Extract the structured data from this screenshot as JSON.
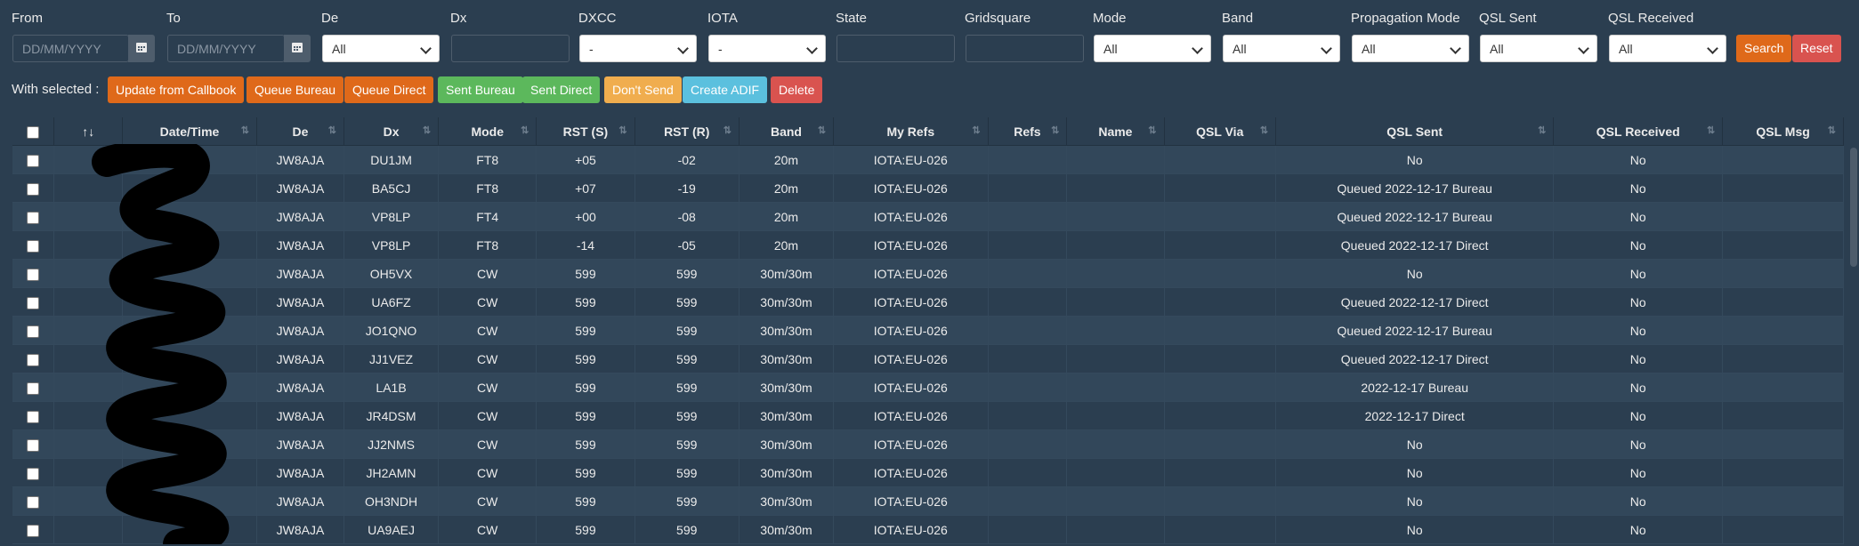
{
  "filters": {
    "from": {
      "label": "From",
      "placeholder": "DD/MM/YYYY"
    },
    "to": {
      "label": "To",
      "placeholder": "DD/MM/YYYY"
    },
    "de": {
      "label": "De",
      "value": "All"
    },
    "dx": {
      "label": "Dx",
      "value": ""
    },
    "dxcc": {
      "label": "DXCC",
      "value": "-"
    },
    "iota": {
      "label": "IOTA",
      "value": "-"
    },
    "state": {
      "label": "State",
      "value": ""
    },
    "gridsquare": {
      "label": "Gridsquare",
      "value": ""
    },
    "mode": {
      "label": "Mode",
      "value": "All"
    },
    "band": {
      "label": "Band",
      "value": "All"
    },
    "propagation": {
      "label": "Propagation Mode",
      "value": "All"
    },
    "qsl_sent": {
      "label": "QSL Sent",
      "value": "All"
    },
    "qsl_received": {
      "label": "QSL Received",
      "value": "All"
    },
    "search_label": "Search",
    "reset_label": "Reset"
  },
  "actions": {
    "with_selected_label": "With selected :",
    "update_callbook": "Update from Callbook",
    "queue_bureau": "Queue Bureau",
    "queue_direct": "Queue Direct",
    "sent_bureau": "Sent Bureau",
    "sent_direct": "Sent Direct",
    "dont_send": "Don't Send",
    "create_adif": "Create ADIF",
    "delete": "Delete"
  },
  "table": {
    "sort_first": "↑↓",
    "headers": [
      "Date/Time",
      "De",
      "Dx",
      "Mode",
      "RST (S)",
      "RST (R)",
      "Band",
      "My Refs",
      "Refs",
      "Name",
      "QSL Via",
      "QSL Sent",
      "QSL Received",
      "QSL Msg"
    ],
    "rows": [
      {
        "de": "JW8AJA",
        "dx": "DU1JM",
        "mode": "FT8",
        "rsts": "+05",
        "rstr": "-02",
        "band": "20m",
        "myrefs": "IOTA:EU-026",
        "qsl_sent": "No",
        "qsl_rcvd": "No"
      },
      {
        "de": "JW8AJA",
        "dx": "BA5CJ",
        "mode": "FT8",
        "rsts": "+07",
        "rstr": "-19",
        "band": "20m",
        "myrefs": "IOTA:EU-026",
        "qsl_sent": "Queued 2022-12-17 Bureau",
        "qsl_rcvd": "No"
      },
      {
        "de": "JW8AJA",
        "dx": "VP8LP",
        "mode": "FT4",
        "rsts": "+00",
        "rstr": "-08",
        "band": "20m",
        "myrefs": "IOTA:EU-026",
        "qsl_sent": "Queued 2022-12-17 Bureau",
        "qsl_rcvd": "No"
      },
      {
        "de": "JW8AJA",
        "dx": "VP8LP",
        "mode": "FT8",
        "rsts": "-14",
        "rstr": "-05",
        "band": "20m",
        "myrefs": "IOTA:EU-026",
        "qsl_sent": "Queued 2022-12-17 Direct",
        "qsl_rcvd": "No"
      },
      {
        "de": "JW8AJA",
        "dx": "OH5VX",
        "mode": "CW",
        "rsts": "599",
        "rstr": "599",
        "band": "30m/30m",
        "myrefs": "IOTA:EU-026",
        "qsl_sent": "No",
        "qsl_rcvd": "No"
      },
      {
        "de": "JW8AJA",
        "dx": "UA6FZ",
        "mode": "CW",
        "rsts": "599",
        "rstr": "599",
        "band": "30m/30m",
        "myrefs": "IOTA:EU-026",
        "qsl_sent": "Queued 2022-12-17 Direct",
        "qsl_rcvd": "No"
      },
      {
        "de": "JW8AJA",
        "dx": "JO1QNO",
        "mode": "CW",
        "rsts": "599",
        "rstr": "599",
        "band": "30m/30m",
        "myrefs": "IOTA:EU-026",
        "qsl_sent": "Queued 2022-12-17 Bureau",
        "qsl_rcvd": "No"
      },
      {
        "de": "JW8AJA",
        "dx": "JJ1VEZ",
        "mode": "CW",
        "rsts": "599",
        "rstr": "599",
        "band": "30m/30m",
        "myrefs": "IOTA:EU-026",
        "qsl_sent": "Queued 2022-12-17 Direct",
        "qsl_rcvd": "No"
      },
      {
        "de": "JW8AJA",
        "dx": "LA1B",
        "mode": "CW",
        "rsts": "599",
        "rstr": "599",
        "band": "30m/30m",
        "myrefs": "IOTA:EU-026",
        "qsl_sent": "2022-12-17 Bureau",
        "qsl_rcvd": "No"
      },
      {
        "de": "JW8AJA",
        "dx": "JR4DSM",
        "mode": "CW",
        "rsts": "599",
        "rstr": "599",
        "band": "30m/30m",
        "myrefs": "IOTA:EU-026",
        "qsl_sent": "2022-12-17 Direct",
        "qsl_rcvd": "No"
      },
      {
        "de": "JW8AJA",
        "dx": "JJ2NMS",
        "mode": "CW",
        "rsts": "599",
        "rstr": "599",
        "band": "30m/30m",
        "myrefs": "IOTA:EU-026",
        "qsl_sent": "No",
        "qsl_rcvd": "No"
      },
      {
        "de": "JW8AJA",
        "dx": "JH2AMN",
        "mode": "CW",
        "rsts": "599",
        "rstr": "599",
        "band": "30m/30m",
        "myrefs": "IOTA:EU-026",
        "qsl_sent": "No",
        "qsl_rcvd": "No"
      },
      {
        "de": "JW8AJA",
        "dx": "OH3NDH",
        "mode": "CW",
        "rsts": "599",
        "rstr": "599",
        "band": "30m/30m",
        "myrefs": "IOTA:EU-026",
        "qsl_sent": "No",
        "qsl_rcvd": "No"
      },
      {
        "de": "JW8AJA",
        "dx": "UA9AEJ",
        "mode": "CW",
        "rsts": "599",
        "rstr": "599",
        "band": "30m/30m",
        "myrefs": "IOTA:EU-026",
        "qsl_sent": "No",
        "qsl_rcvd": "No"
      }
    ]
  }
}
